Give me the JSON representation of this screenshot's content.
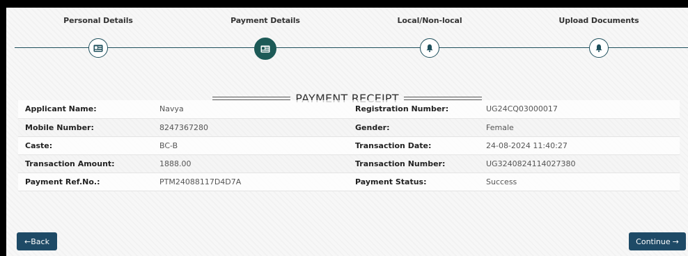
{
  "stepper": {
    "steps": [
      {
        "label": "Personal Details",
        "icon": "id-card-icon",
        "active": false
      },
      {
        "label": "Payment Details",
        "icon": "id-card-icon",
        "active": true
      },
      {
        "label": "Local/Non-local",
        "icon": "bell-icon",
        "active": false
      },
      {
        "label": "Upload Documents",
        "icon": "bell-icon",
        "active": false
      }
    ]
  },
  "receipt": {
    "title": "PAYMENT RECEIPT",
    "rows": [
      {
        "l_label": "Applicant Name:",
        "l_value": "Navya",
        "r_label": "Registration Number:",
        "r_value": "UG24CQ03000017"
      },
      {
        "l_label": "Mobile Number:",
        "l_value": "8247367280",
        "r_label": "Gender:",
        "r_value": "Female"
      },
      {
        "l_label": "Caste:",
        "l_value": "BC-B",
        "r_label": "Transaction Date:",
        "r_value": "24-08-2024 11:40:27"
      },
      {
        "l_label": "Transaction Amount:",
        "l_value": "1888.00",
        "r_label": "Transaction Number:",
        "r_value": "UG3240824114027380"
      },
      {
        "l_label": "Payment Ref.No.:",
        "l_value": "PTM24088117D4D7A",
        "r_label": "Payment Status:",
        "r_value": "Success"
      }
    ]
  },
  "actions": {
    "back_arrow": "←",
    "back_label": "Back",
    "continue_label": "Continue",
    "continue_arrow": "→"
  },
  "colors": {
    "accent": "#1d5a57",
    "button": "#1e4a66"
  }
}
